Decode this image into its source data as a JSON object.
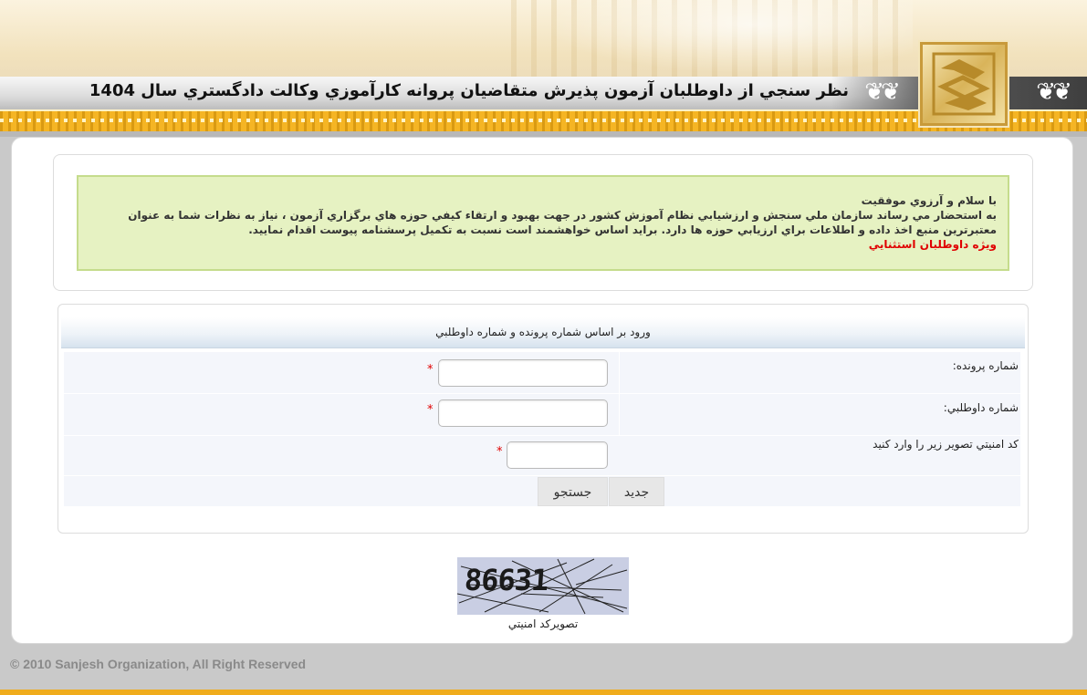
{
  "header": {
    "title": "نظر سنجي از داوطلبان آزمون پذيرش متقاضيان پروانه كارآموزي وكالت دادگستري سال 1404"
  },
  "notice": {
    "line1": "با سلام و آرزوي موفقيت",
    "line2": "به استحضار مي رساند سازمان ملي سنجش و ارزشيابي نظام آموزش كشور در جهت بهبود و ارتقاء كيفي حوزه هاي برگزاري آزمون ، نياز به نظرات شما به عنوان",
    "line3": "معتبرترين منبع اخذ داده و اطلاعات براي ارزيابي حوزه ها دارد. برايد اساس خواهشمند است نسبت به تكميل پرسشنامه پيوست اقدام نماييد.",
    "line4_red": "ويژه داوطلبان استثنايي"
  },
  "form": {
    "header": "ورود بر اساس شماره پرونده و شماره داوطلبي",
    "file_number_label": "شماره پرونده:",
    "candidate_number_label": "شماره داوطلبي:",
    "security_code_label": "كد امنيتي تصوير زير را وارد كنيد",
    "required_mark": "*",
    "new_button": "جديد",
    "search_button": "جستجو",
    "file_number_value": "",
    "candidate_number_value": "",
    "security_code_value": ""
  },
  "captcha": {
    "code": "86631",
    "caption": "تصويركد امنيتي"
  },
  "footer": {
    "copyright": "© 2010 Sanjesh Organization, All Right Reserved"
  },
  "colors": {
    "gold": "#f0ac1c",
    "notice_bg": "#e6f2c2",
    "required": "#e00000"
  }
}
